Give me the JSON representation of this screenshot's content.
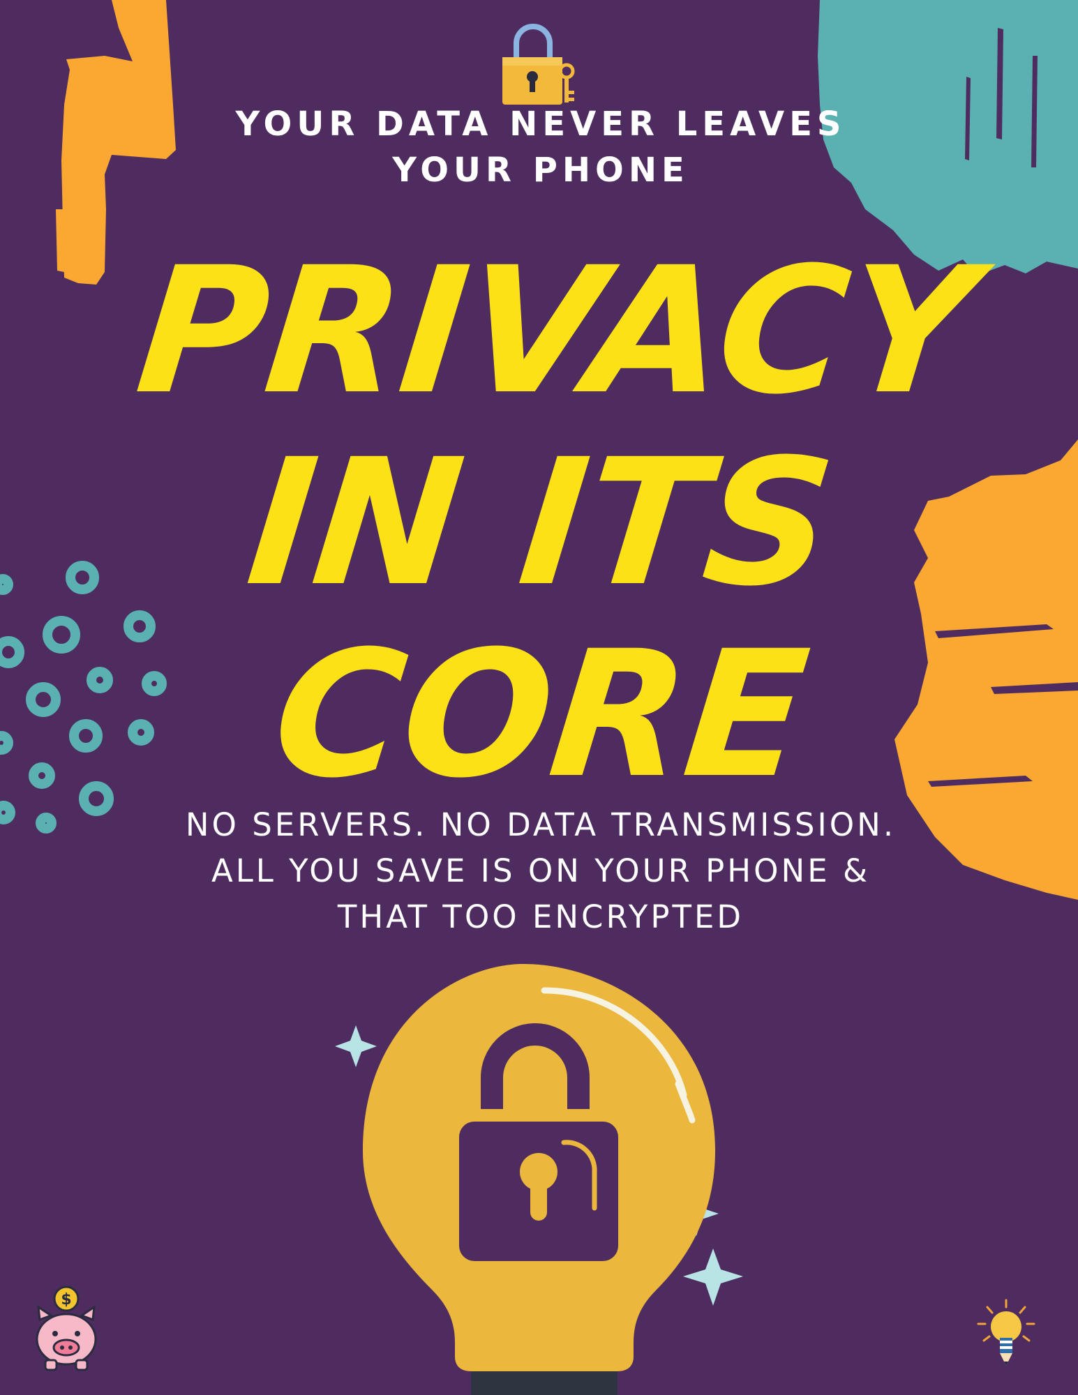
{
  "subtitle": "YOUR DATA NEVER LEAVES YOUR PHONE",
  "title_lines": [
    "PRIVACY",
    "IN ITS",
    "CORE"
  ],
  "body_lines": [
    "NO SERVERS. NO DATA TRANSMISSION.",
    "ALL YOU SAVE IS ON YOUR PHONE &",
    "THAT TOO ENCRYPTED"
  ],
  "icons": {
    "top": "lock-and-key-icon",
    "center": "lightbulb-lock-icon",
    "bottom_left": "piggy-bank-icon",
    "bottom_right": "lightbulb-pencil-icon",
    "piggy_coin_symbol": "$"
  },
  "colors": {
    "background": "#4f2c5f",
    "title": "#fde117",
    "orange_brush": "#fba832",
    "teal_brush": "#5bb1b1",
    "bulb": "#ebb73d"
  }
}
